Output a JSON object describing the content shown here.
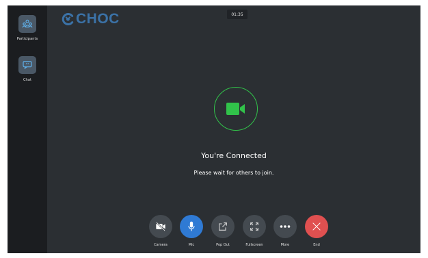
{
  "app": {
    "logo_text": "CHOC",
    "timer": "01:35"
  },
  "sidebar": {
    "items": [
      {
        "label": "Participants",
        "icon": "participants-icon"
      },
      {
        "label": "Chat",
        "icon": "chat-icon"
      }
    ]
  },
  "status": {
    "icon": "video-camera-icon",
    "title": "You're Connected",
    "subtitle": "Please wait for others to join."
  },
  "controls": [
    {
      "label": "Camera",
      "icon": "camera-off-icon",
      "state": "off"
    },
    {
      "label": "Mic",
      "icon": "microphone-icon",
      "state": "on"
    },
    {
      "label": "Pop Out",
      "icon": "pop-out-icon",
      "state": "neutral"
    },
    {
      "label": "Fullscreen",
      "icon": "fullscreen-icon",
      "state": "neutral"
    },
    {
      "label": "More",
      "icon": "more-icon",
      "state": "neutral"
    },
    {
      "label": "End",
      "icon": "end-call-icon",
      "state": "end"
    }
  ],
  "colors": {
    "background": "#2b2f33",
    "sidebar": "#1b1d20",
    "accent_green": "#31c24a",
    "mic_active": "#2f7ad4",
    "end_red": "#e05050",
    "logo_blue": "#3b72a7"
  }
}
